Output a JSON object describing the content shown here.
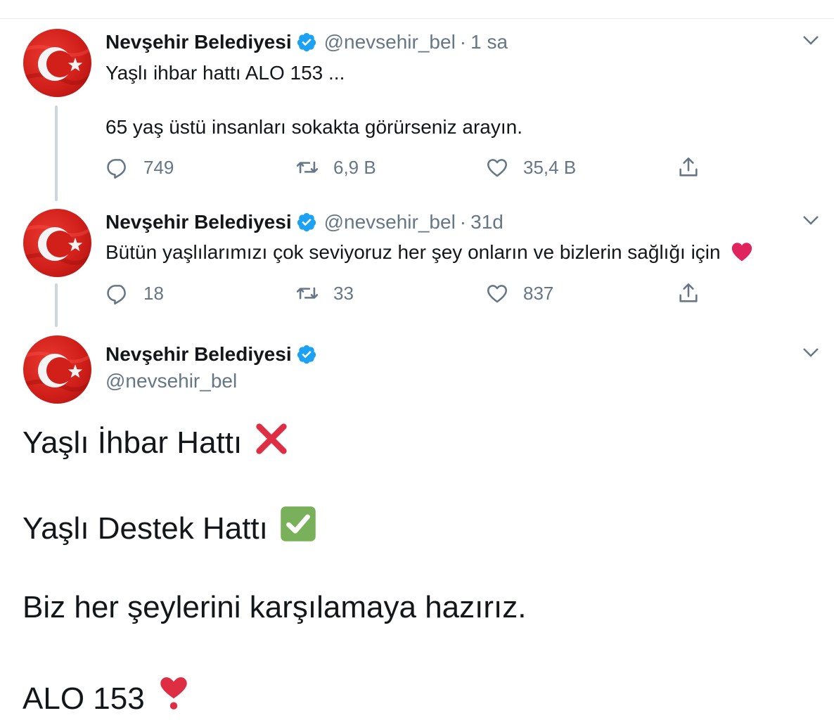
{
  "colors": {
    "accent": "#1da1f2",
    "muted": "#657786",
    "text": "#14171a",
    "thread_line": "#ccd6dd",
    "heart_red": "#e0245e"
  },
  "tweets": [
    {
      "name": "Nevşehir Belediyesi",
      "handle": "@nevsehir_bel",
      "separator": "·",
      "time": "1 sa",
      "line1": "Yaşlı ihbar hattı ALO 153 ...",
      "line2": "65 yaş üstü insanları sokakta görürseniz arayın.",
      "replies": "749",
      "retweets": "6,9 B",
      "likes": "35,4 B"
    },
    {
      "name": "Nevşehir Belediyesi",
      "handle": "@nevsehir_bel",
      "separator": "·",
      "time": "31d",
      "line1": "Bütün yaşlılarımızı çok seviyoruz her şey onların ve bizlerin sağlığı için",
      "trailing_emoji": "red-heart",
      "replies": "18",
      "retweets": "33",
      "likes": "837"
    }
  ],
  "main_tweet": {
    "name": "Nevşehir Belediyesi",
    "handle": "@nevsehir_bel",
    "line1": "Yaşlı İhbar Hattı",
    "line1_emoji": "cross-mark",
    "line2": "Yaşlı Destek Hattı",
    "line2_emoji": "check-mark-button",
    "line3": "Biz her şeylerini karşılamaya hazırız.",
    "line4": "ALO 153",
    "line4_emoji": "heavy-heart-exclamation"
  },
  "icons": {
    "reply": "reply-icon",
    "retweet": "retweet-icon",
    "like": "like-icon",
    "share": "share-icon",
    "verified": "verified-badge-icon",
    "more": "chevron-down-icon"
  }
}
